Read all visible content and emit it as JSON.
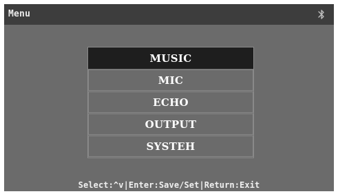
{
  "title_bar": {
    "title": "Menu",
    "bluetooth_icon": "bluetooth-icon"
  },
  "menu": {
    "selected_index": 0,
    "items": [
      {
        "label": "MUSIC"
      },
      {
        "label": "MIC"
      },
      {
        "label": "ECHO"
      },
      {
        "label": "OUTPUT"
      },
      {
        "label": "SYSTEH"
      }
    ]
  },
  "status_bar": {
    "hint": "Select:^v|Enter:Save/Set|Return:Exit"
  },
  "colors": {
    "screen_bg": "#6b6b6b",
    "title_bar_bg": "#3d3d3d",
    "selected_item_bg": "#1e1e1e",
    "text": "#ffffff"
  }
}
